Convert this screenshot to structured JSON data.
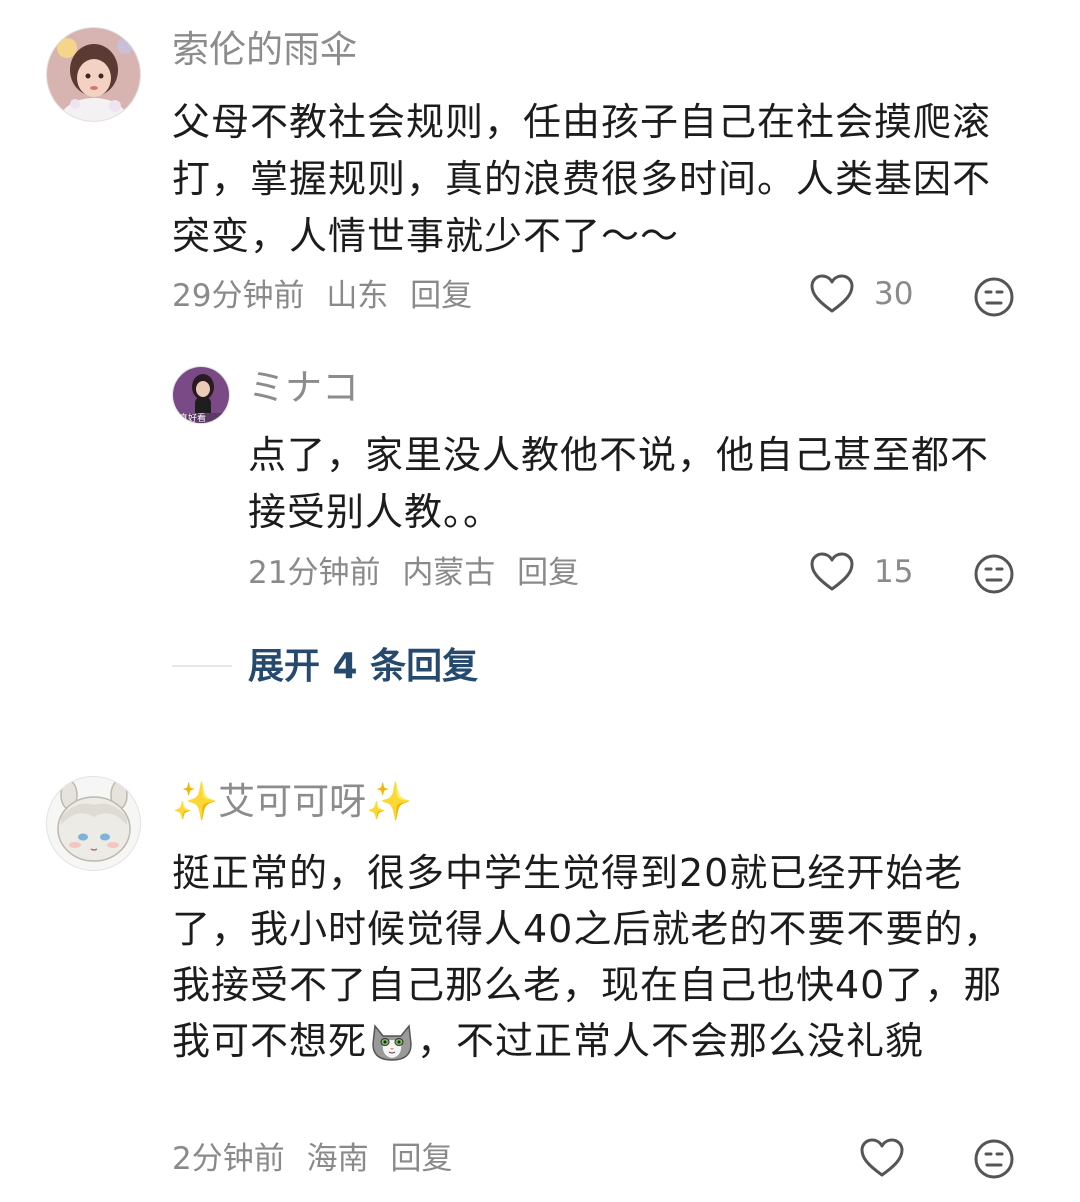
{
  "comments": [
    {
      "username": "索伦的雨伞",
      "text": "父母不教社会规则，任由孩子自己在社会摸爬滚打，掌握规则，真的浪费很多时间。人类基因不突变，人情世事就少不了～～",
      "time": "29分钟前",
      "location": "山东",
      "reply_label": "回复",
      "likes": "30",
      "replies": [
        {
          "username": "ミナコ",
          "text": "点了，家里没人教他不说，他自己甚至都不接受别人教。。",
          "time": "21分钟前",
          "location": "内蒙古",
          "reply_label": "回复",
          "likes": "15",
          "avatar_badge": "真好看"
        }
      ],
      "expand_label": "展开 4 条回复"
    },
    {
      "username_prefix": "✨",
      "username": "艾可可呀",
      "username_suffix": "✨",
      "text_part1": "挺正常的，很多中学生觉得到20就已经开始老了，我小时候觉得人40之后就老的不要不要的，我接受不了自己那么老，现在自己也快40了，那我可不想死",
      "text_part2": "，不过正常人不会那么没礼貌",
      "emoji_name": "cat-face-emoji",
      "time": "2分钟前",
      "location": "海南",
      "reply_label": "回复",
      "likes": ""
    }
  ],
  "colors": {
    "username": "#8c8c8c",
    "meta": "#8a8a8a",
    "text": "#1c1c1c",
    "expand_link": "#264a6e",
    "sparkle": "#f5c518"
  }
}
